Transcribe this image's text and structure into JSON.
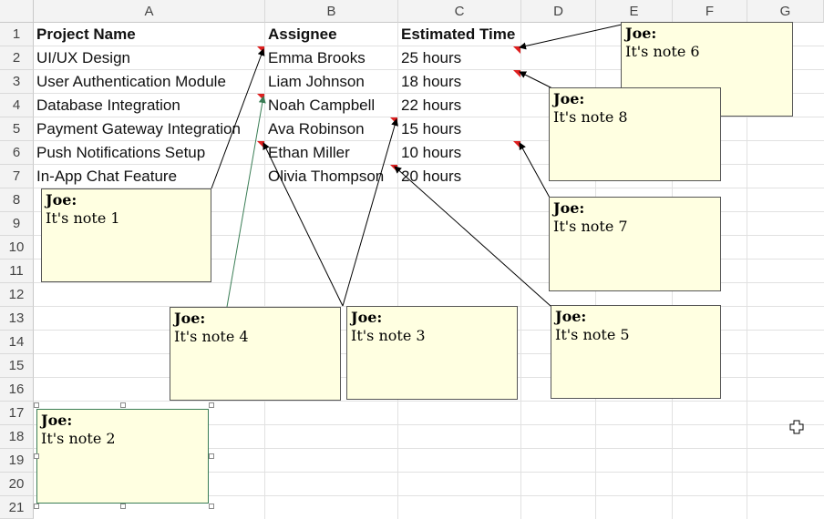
{
  "columns": [
    "A",
    "B",
    "C",
    "D",
    "E",
    "F",
    "G"
  ],
  "rows": [
    "1",
    "2",
    "3",
    "4",
    "5",
    "6",
    "7",
    "8",
    "9",
    "10",
    "11",
    "12",
    "13",
    "14",
    "15",
    "16",
    "17",
    "18",
    "19",
    "20",
    "21"
  ],
  "cells": {
    "header": {
      "project": "Project Name",
      "assignee": "Assignee",
      "time": "Estimated Time"
    },
    "data": [
      {
        "project": "UI/UX Design",
        "assignee": "Emma Brooks",
        "time": "25 hours"
      },
      {
        "project": "User Authentication Module",
        "assignee": "Liam Johnson",
        "time": "18 hours"
      },
      {
        "project": "Database Integration",
        "assignee": "Noah Campbell",
        "time": "22 hours"
      },
      {
        "project": "Payment Gateway Integration",
        "assignee": "Ava Robinson",
        "time": "15 hours"
      },
      {
        "project": "Push Notifications Setup",
        "assignee": "Ethan Miller",
        "time": "10 hours"
      },
      {
        "project": "In-App Chat Feature",
        "assignee": "Olivia Thompson",
        "time": "20 hours"
      }
    ]
  },
  "notes": [
    {
      "author": "Joe:",
      "text": "It's note 1"
    },
    {
      "author": "Joe:",
      "text": "It's note 2"
    },
    {
      "author": "Joe:",
      "text": "It's note 3"
    },
    {
      "author": "Joe:",
      "text": "It's note 4"
    },
    {
      "author": "Joe:",
      "text": "It's note 5"
    },
    {
      "author": "Joe:",
      "text": "It's note 6"
    },
    {
      "author": "Joe:",
      "text": "It's note 7"
    },
    {
      "author": "Joe:",
      "text": "It's note 8"
    }
  ],
  "colors": {
    "note_bg": "#ffffe1",
    "comment_flag": "#e02020",
    "selected_connector": "#3a7d55"
  },
  "icons": {
    "cursor": "cell-select-cross-icon"
  }
}
